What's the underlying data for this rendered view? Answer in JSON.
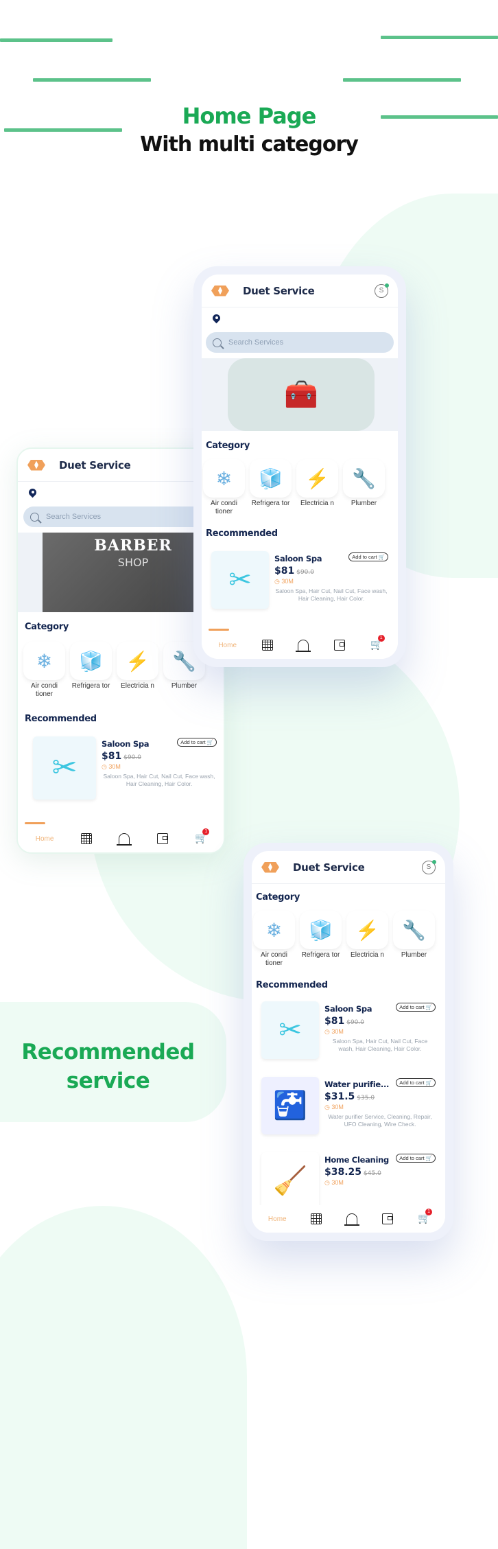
{
  "headline": {
    "title": "Home Page",
    "subtitle": "With multi category"
  },
  "side_caption": {
    "line1": "Recommended",
    "line2": "service"
  },
  "colors": {
    "brand_green": "#1aa955",
    "accent_orange": "#f0a05a",
    "navy": "#13254f",
    "badge_red": "#e5202a"
  },
  "app": {
    "title": "Duet Service",
    "logo_icon": "hexagon-logo-icon",
    "profile_icon": "profile-icon",
    "search_placeholder": "Search Services",
    "banner_main": "service-workers-illustration",
    "banner_alt": {
      "line1": "BARBER",
      "line2": "SHOP"
    },
    "category_heading": "Category",
    "recommended_heading": "Recommended",
    "categories": [
      {
        "label": "Air condi tioner",
        "icon": "air-conditioner-icon",
        "glyph": "❄"
      },
      {
        "label": "Refrigera tor",
        "icon": "refrigerator-icon",
        "glyph": "🧊"
      },
      {
        "label": "Electricia n",
        "icon": "electrician-icon",
        "glyph": "⚡"
      },
      {
        "label": "Plumber",
        "icon": "plumber-icon",
        "glyph": "🔧"
      }
    ],
    "recommended": [
      {
        "name": "Saloon Spa",
        "price": "$81",
        "old_price": "$90.0",
        "duration": "30M",
        "description": "Saloon Spa, Hair Cut, Nail Cut, Face wash, Hair Cleaning, Hair Color.",
        "add_to_cart": "Add to cart",
        "thumb": "✂"
      },
      {
        "name": "Water purifie...",
        "price": "$31.5",
        "old_price": "$35.0",
        "duration": "30M",
        "description": "Water purifier Service, Cleaning, Repair, UFO Cleaning, Wire Check.",
        "add_to_cart": "Add to cart",
        "thumb": "🚰"
      },
      {
        "name": "Home Cleaning",
        "price": "$38.25",
        "old_price": "$45.0",
        "duration": "30M",
        "description": "",
        "add_to_cart": "Add to cart",
        "thumb": "🧹"
      }
    ],
    "nav": {
      "home": "Home",
      "cart_badge": "1"
    }
  }
}
